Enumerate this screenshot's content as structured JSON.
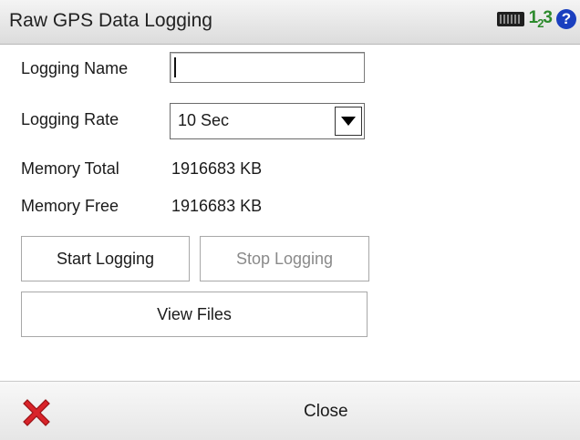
{
  "titlebar": {
    "title": "Raw GPS Data Logging",
    "input_mode_main": "1",
    "input_mode_sub": "2",
    "input_mode_end": "3",
    "help_symbol": "?"
  },
  "form": {
    "logging_name_label": "Logging Name",
    "logging_name_value": "",
    "logging_rate_label": "Logging Rate",
    "logging_rate_value": "10 Sec",
    "memory_total_label": "Memory Total",
    "memory_total_value": "1916683 KB",
    "memory_free_label": "Memory Free",
    "memory_free_value": "1916683 KB"
  },
  "buttons": {
    "start_logging": "Start Logging",
    "stop_logging": "Stop Logging",
    "view_files": "View Files"
  },
  "bottombar": {
    "close_label": "Close"
  },
  "icons": {
    "keyboard": "keyboard-icon",
    "input_mode": "input-mode-icon",
    "help": "help-icon",
    "close": "close-icon"
  },
  "colors": {
    "help_blue": "#1a3fbf",
    "input_mode_green": "#2c8a2c",
    "close_red": "#d8242a"
  }
}
